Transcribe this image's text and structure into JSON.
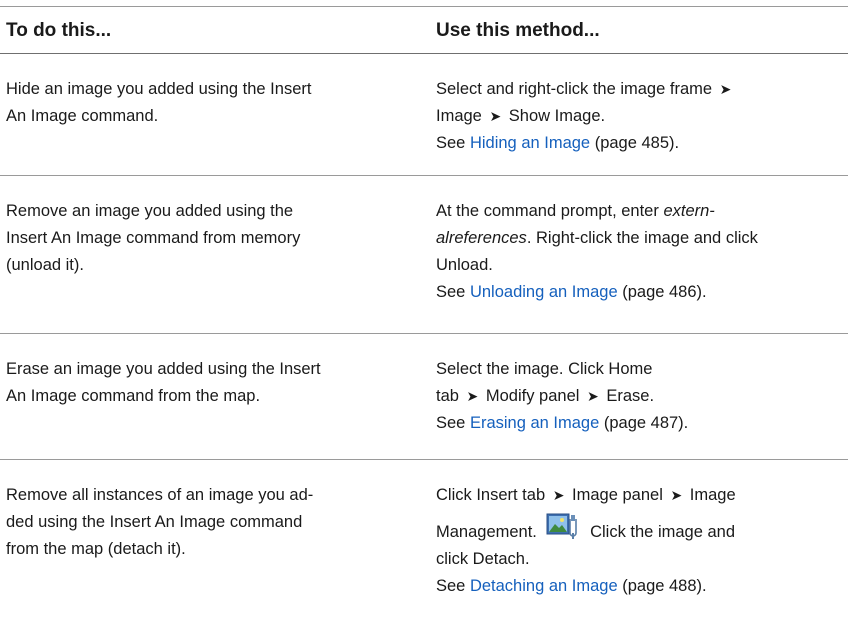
{
  "header": {
    "col1": "To do this...",
    "col2": "Use this method..."
  },
  "rows": [
    {
      "task_line1": "Hide an image you added using the Insert",
      "task_line2": "An Image command.",
      "method": {
        "line1_a": "Select and right-click the image frame",
        "arrow": "➤",
        "line2_a": "Image",
        "line2_b": "Show Image.",
        "see_prefix": "See ",
        "link": "Hiding an Image",
        "see_suffix": " (page 485)."
      }
    },
    {
      "task_line1": "Remove an image you added using the",
      "task_line2": "Insert An Image command from memory",
      "task_line3": "(unload it).",
      "method": {
        "line1_a": "At the command prompt, enter ",
        "line1_em": "extern-",
        "line2_em": "alreferences",
        "line2_b": ". Right-click the image and click",
        "line3": "Unload.",
        "see_prefix": "See ",
        "link": "Unloading an Image",
        "see_suffix": " (page 486)."
      }
    },
    {
      "task_line1": "Erase an image you added using the Insert",
      "task_line2": "An Image command from the map.",
      "method": {
        "line1": "Select the image. Click Home",
        "line2_a": "tab",
        "arrow": "➤",
        "line2_b": "Modify panel",
        "line2_c": "Erase.",
        "see_prefix": "See ",
        "link": "Erasing an Image",
        "see_suffix": " (page 487)."
      }
    },
    {
      "task_line1": "Remove all instances of an image you ad-",
      "task_line2": "ded using the Insert An Image command",
      "task_line3": "from the map (detach it).",
      "method": {
        "line1_a": "Click Insert tab",
        "arrow": "➤",
        "line1_b": "Image panel",
        "line1_c": "Image",
        "line2_a": "Management.",
        "line2_b": "Click the image and",
        "line3": "click Detach.",
        "see_prefix": "See ",
        "link": "Detaching an Image",
        "see_suffix": " (page 488)."
      }
    }
  ],
  "colors": {
    "link": "#1560bd",
    "rule": "#9a9a9a",
    "text": "#1a1a1a"
  },
  "icons": [
    "image-management-icon"
  ]
}
